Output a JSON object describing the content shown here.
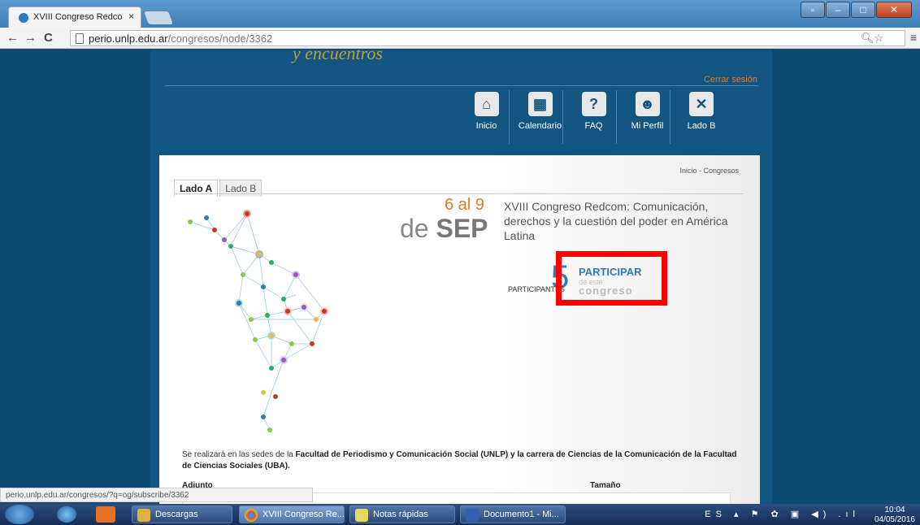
{
  "browser": {
    "tab_title": "XVIII Congreso Redcom |",
    "tab_close": "×",
    "url_host": "perio.unlp.edu.ar",
    "url_path": "/congresos/node/3362",
    "nav_back": "←",
    "nav_forward": "→",
    "nav_reload": "C",
    "status_url": "perio.unlp.edu.ar/congresos/?q=og/subscribe/3362"
  },
  "site": {
    "top_script": "y encuentros",
    "logout": "Cerrar sesión",
    "nav": [
      {
        "label": "Inicio",
        "icon": "⌂"
      },
      {
        "label": "Calendario",
        "icon": "▦"
      },
      {
        "label": "FAQ",
        "icon": "?"
      },
      {
        "label": "Mi Perfil",
        "icon": "☻"
      },
      {
        "label": "Lado B",
        "icon": "✕"
      }
    ]
  },
  "content": {
    "breadcrumb": "Inicio - Congresos",
    "tabs": [
      "Lado A",
      "Lado B"
    ],
    "date_days": "6 al 9",
    "date_prefix": "de",
    "date_month": "SEP",
    "title": "XVIII Congreso Redcom: Comunicación, derechos y la cuestión del poder en América Latina",
    "participants_count": "5",
    "participants_label": "PARTICIPANTES",
    "participar_main": "PARTICIPAR",
    "participar_sub1": "de este",
    "participar_sub2": "congreso",
    "desc_pre": "Se realizará en las sedes de la ",
    "desc_b1": "Facultad de Periodismo y Comunicación Social (UNLP) y la carrera de Ciencias de la Comunicación de la Facultad de Ciencias Sociales (UBA).",
    "col_attachment": "Adjunto",
    "col_size": "Tamaño"
  },
  "taskbar": {
    "items": [
      "Descargas",
      "XVIII Congreso Re...",
      "Notas rápidas",
      "Documento1 - Mi..."
    ],
    "lang": "ES",
    "time": "10:04",
    "date": "04/05/2016"
  }
}
